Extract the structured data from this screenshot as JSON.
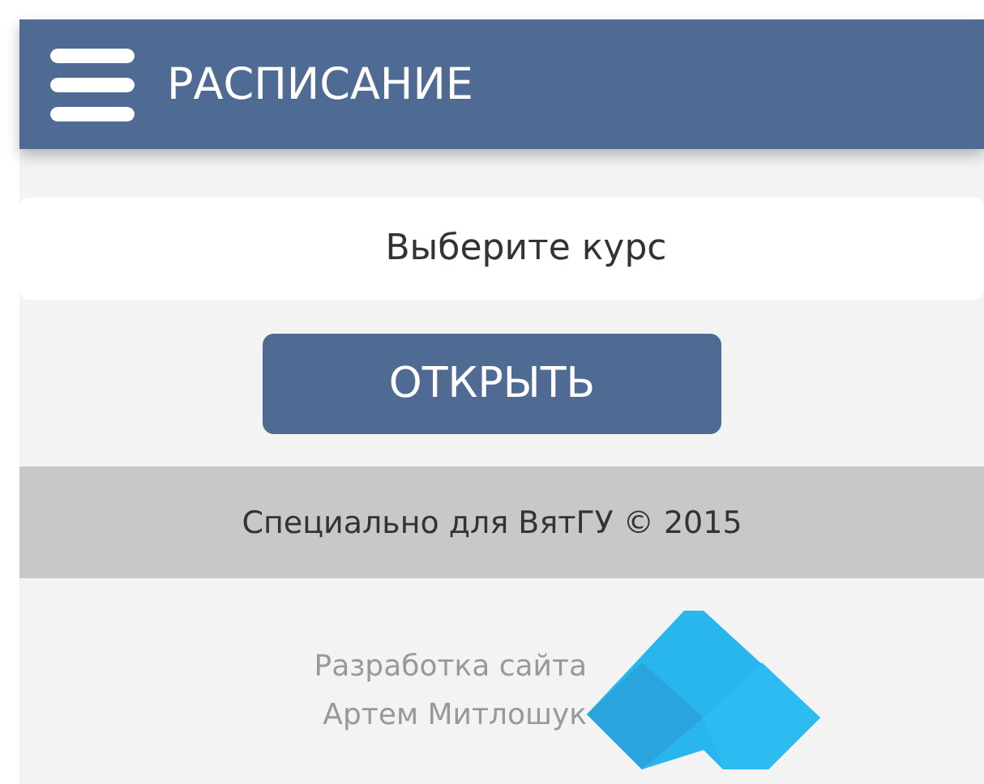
{
  "header": {
    "title": "РАСПИСАНИЕ"
  },
  "course_select": {
    "value": "Выберите курс"
  },
  "open_button": {
    "label": "ОТКРЫТЬ"
  },
  "footer": {
    "text": "Специально для ВятГУ © 2015"
  },
  "credits": {
    "lines": [
      "Разработка сайта",
      "Артем Митлошук"
    ]
  }
}
